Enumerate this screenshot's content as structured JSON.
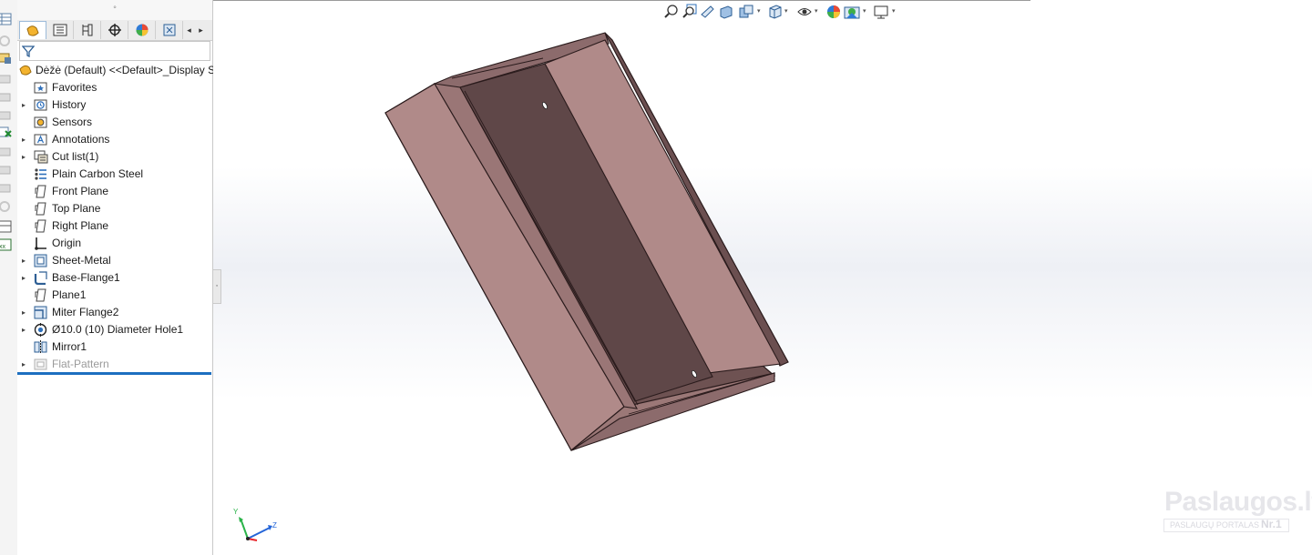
{
  "panel": {
    "grip_symbol": "°",
    "tabs": [
      {
        "name": "feature-manager-tab-icon",
        "active": true
      },
      {
        "name": "property-manager-tab-icon",
        "active": false
      },
      {
        "name": "configuration-manager-tab-icon",
        "active": false
      },
      {
        "name": "dimxpert-manager-tab-icon",
        "active": false
      },
      {
        "name": "display-manager-tab-icon",
        "active": false
      },
      {
        "name": "cam-tab-icon",
        "active": false
      }
    ],
    "tab_scroll_left": "◂",
    "tab_scroll_right": "▸",
    "filter_icon": "funnel-icon"
  },
  "tree": {
    "root": "Dėžė (Default) <<Default>_Display S",
    "items": [
      {
        "label": "Favorites",
        "icon": "favorites-folder-icon",
        "expandable": false
      },
      {
        "label": "History",
        "icon": "history-folder-icon",
        "expandable": true
      },
      {
        "label": "Sensors",
        "icon": "sensors-folder-icon",
        "expandable": false
      },
      {
        "label": "Annotations",
        "icon": "annotations-folder-icon",
        "expandable": true
      },
      {
        "label": "Cut list(1)",
        "icon": "cut-list-icon",
        "expandable": true
      },
      {
        "label": "Plain Carbon Steel",
        "icon": "material-icon",
        "expandable": false
      },
      {
        "label": "Front Plane",
        "icon": "plane-icon",
        "expandable": false
      },
      {
        "label": "Top Plane",
        "icon": "plane-icon",
        "expandable": false
      },
      {
        "label": "Right Plane",
        "icon": "plane-icon",
        "expandable": false
      },
      {
        "label": "Origin",
        "icon": "origin-icon",
        "expandable": false
      },
      {
        "label": "Sheet-Metal",
        "icon": "sheet-metal-icon",
        "expandable": true
      },
      {
        "label": "Base-Flange1",
        "icon": "base-flange-icon",
        "expandable": true
      },
      {
        "label": "Plane1",
        "icon": "plane-icon",
        "expandable": false
      },
      {
        "label": "Miter Flange2",
        "icon": "miter-flange-icon",
        "expandable": true
      },
      {
        "label": "Ø10.0 (10) Diameter Hole1",
        "icon": "hole-wizard-icon",
        "expandable": true
      },
      {
        "label": "Mirror1",
        "icon": "mirror-icon",
        "expandable": false
      },
      {
        "label": "Flat-Pattern",
        "icon": "flat-pattern-icon",
        "expandable": true,
        "suppressed": true
      }
    ],
    "expand_arrow": "▸"
  },
  "hud": {
    "buttons": [
      "zoom-to-fit-icon",
      "zoom-to-area-icon",
      "previous-view-icon",
      "section-view-icon",
      "dynamic-annotation-view-icon",
      "view-orientation-icon",
      "display-style-icon",
      "hide-show-items-icon",
      "edit-appearance-icon",
      "apply-scene-icon",
      "view-settings-icon"
    ],
    "dropdown_symbol": "▾"
  },
  "triad": {
    "x_label": "",
    "y_label": "Y",
    "z_label": "Z"
  },
  "watermark": {
    "title": "Paslaugos.lt",
    "subtitle": "PASLAUGŲ PORTALAS",
    "badge": "Nr.1"
  },
  "colors": {
    "part_dark": "#5f4748",
    "part_mid": "#8c6b6c",
    "part_light": "#b08a89",
    "selection_blue": "#1d6fc0",
    "x_axis": "#e8262b",
    "y_axis": "#2bb34a",
    "z_axis": "#2465d8"
  }
}
